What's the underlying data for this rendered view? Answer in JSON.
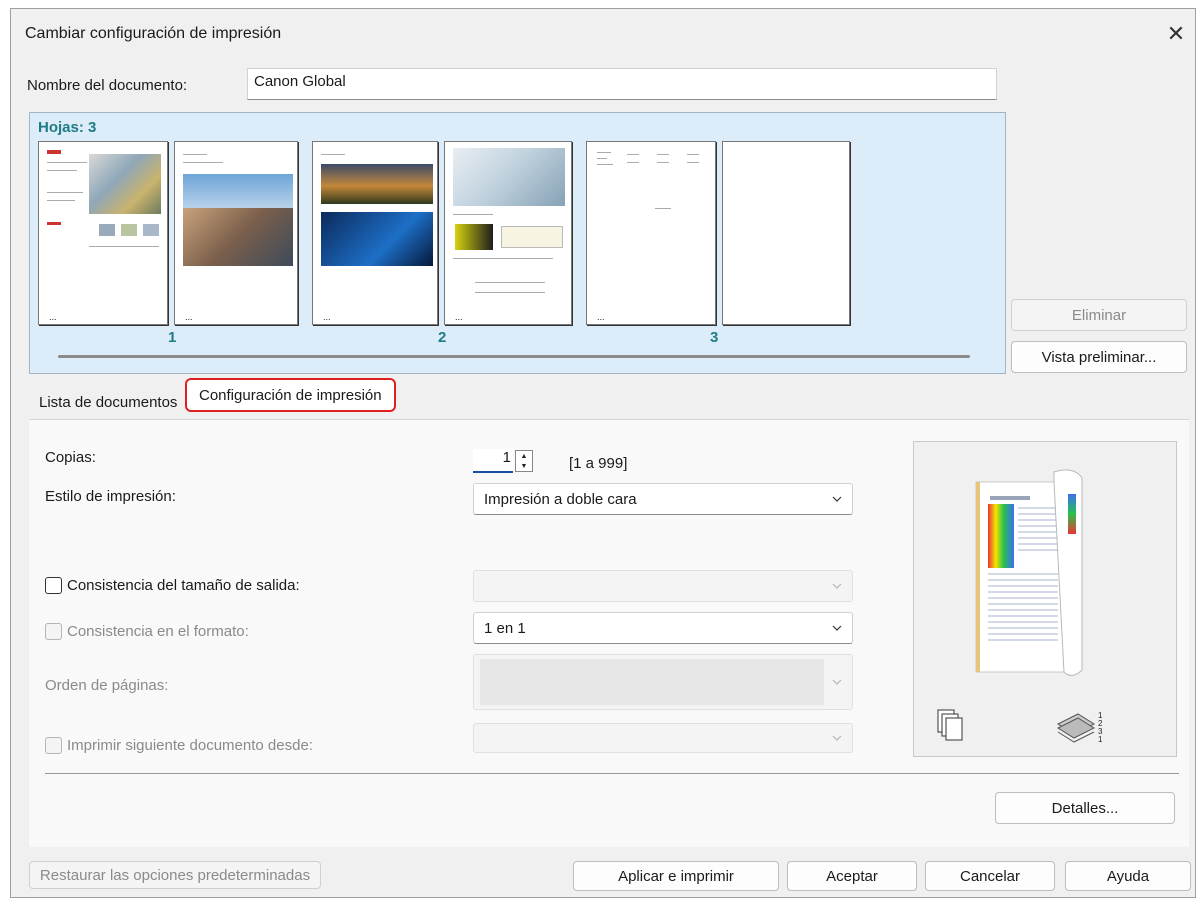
{
  "window": {
    "title": "Cambiar configuración de impresión",
    "close_label": "✕"
  },
  "document": {
    "name_label": "Nombre del documento:",
    "name_value": "Canon Global"
  },
  "sheets": {
    "label": "Hojas: 3",
    "numbers": [
      "1",
      "2",
      "3"
    ],
    "thumb_footer": "..."
  },
  "side_buttons": {
    "delete": "Eliminar",
    "preview": "Vista preliminar..."
  },
  "tabs": [
    {
      "label": "Lista de documentos",
      "active": false
    },
    {
      "label": "Configuración de impresión",
      "active": true
    }
  ],
  "settings": {
    "copies_label": "Copias:",
    "copies_value": "1",
    "copies_range": "[1 a 999]",
    "style_label": "Estilo de impresión:",
    "style_value": "Impresión a doble cara",
    "size_consistency_label": "Consistencia del tamaño de salida:",
    "size_consistency_value": "",
    "format_consistency_label": "Consistencia en el formato:",
    "format_consistency_value": "1 en 1",
    "page_order_label": "Orden de páginas:",
    "page_order_value": "",
    "next_doc_label": "Imprimir siguiente documento desde:",
    "next_doc_value": "",
    "details_button": "Detalles..."
  },
  "footer": {
    "restore": "Restaurar las opciones predeterminadas",
    "apply_print": "Aplicar e imprimir",
    "accept": "Aceptar",
    "cancel": "Cancelar",
    "help": "Ayuda"
  },
  "colors": {
    "accent": "#1e7c84",
    "tab_highlight": "#e02020",
    "sheets_bg": "#dcecf8"
  }
}
